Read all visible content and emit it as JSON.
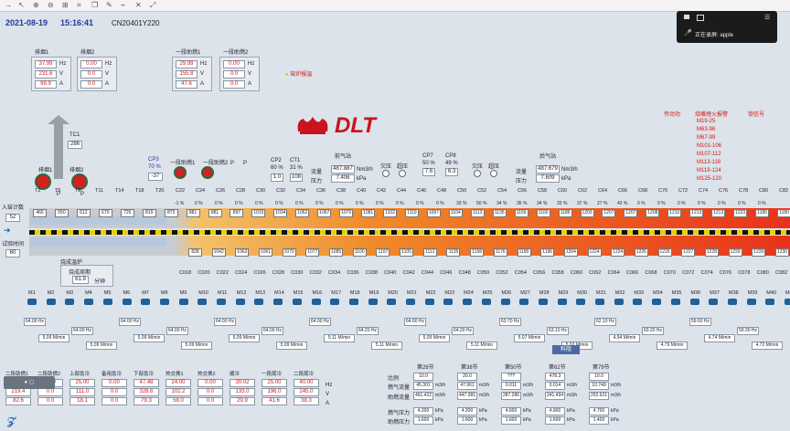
{
  "toolbar": {
    "icons": [
      "back-arrow",
      "cursor",
      "zoom-in",
      "zoom-out",
      "zoom-fit",
      "crop",
      "copy",
      "pen",
      "paperclip",
      "close-x",
      "expand"
    ]
  },
  "header": {
    "date": "2021-08-19",
    "time": "15:16:41",
    "code": "CN20401Y220"
  },
  "overlay": {
    "label": "正在录屏: apple"
  },
  "fans": [
    {
      "title": "排烟1",
      "hz": "37.99",
      "v": "231.6",
      "a": "99.9"
    },
    {
      "title": "排烟2",
      "hz": "0.00",
      "v": "0.0",
      "a": "0.0"
    },
    {
      "title": "一段助燃1",
      "hz": "29.99",
      "v": "155.8",
      "a": "47.6"
    },
    {
      "title": "一段助燃2",
      "hz": "0.00",
      "v": "0.0",
      "a": "0.0"
    }
  ],
  "units": {
    "hz": "Hz",
    "v": "V",
    "a": "A"
  },
  "kiln_alarm": "窑炉报温",
  "logo": "DLT",
  "tc1": {
    "label": "TC1",
    "value": "286"
  },
  "exhaust_labels": {
    "f1": "排烟1",
    "f2": "排烟2",
    "p": "P"
  },
  "burner_labels": {
    "b1": "一段助燃1",
    "b2": "一段助燃2",
    "p": "P"
  },
  "cp3": {
    "label": "CP3",
    "pct": "70 %",
    "val": "-37"
  },
  "cp2": {
    "label": "CP2",
    "pct": "60 %",
    "val": "1.0"
  },
  "ct1": {
    "label": "CT1",
    "pct": "31 %",
    "val": "108"
  },
  "front_gas": {
    "title": "前气站",
    "flow_label": "流量",
    "flow": "487.887",
    "flow_unit": "Nm3/h",
    "press_label": "压力",
    "press": "7.406",
    "press_unit": "kPa"
  },
  "rear_gas": {
    "title": "后气站",
    "flow_label": "流量",
    "flow": "487.679",
    "flow_unit": "Nm3/h",
    "press_label": "压力",
    "press": "7.609",
    "press_unit": "kPa"
  },
  "cp7": {
    "label": "CP7",
    "pct": "50 %",
    "val": "7.6"
  },
  "cp8": {
    "label": "CP8",
    "pct": "49 %",
    "val": "6.3"
  },
  "pressure_marks": {
    "under": "欠压",
    "over": "超压"
  },
  "right_red": {
    "title1": "传动功",
    "title2": "烧嘴熄火报警",
    "title3": "锁信号",
    "items": [
      "M19-25",
      "M63-96",
      "M67-99",
      "M101-106",
      "M107-112",
      "M113-118",
      "M119-124",
      "M125-120"
    ]
  },
  "entry": {
    "count_label": "入窑计数",
    "count": "52",
    "time_label": "试验时间",
    "time": "60"
  },
  "zone_top": [
    "T2",
    "T5",
    "T8",
    "T11",
    "T14",
    "T18",
    "T20",
    "C22",
    "C24",
    "C26",
    "C28",
    "C30",
    "C32",
    "C34",
    "C36",
    "C38",
    "C40",
    "C42",
    "C44",
    "C46",
    "C48",
    "C50",
    "C52",
    "C54",
    "C56",
    "C58",
    "C60",
    "C62",
    "C64",
    "C66",
    "C68",
    "C70",
    "C72",
    "C74",
    "C76",
    "C78",
    "C80",
    "C82"
  ],
  "top_temps": [
    "466",
    "550",
    "612",
    "670",
    "726",
    "819",
    "873",
    "881",
    "881",
    "897",
    "1015",
    "1034",
    "1062",
    "1067",
    "1070",
    "1081",
    "1102",
    "1119",
    "1097",
    "1104",
    "1113",
    "1135",
    "1156",
    "1160",
    "1186",
    "1203",
    "1207",
    "1207",
    "1208",
    "1210",
    "1213",
    "1213",
    "1223",
    "1180",
    "1180"
  ],
  "top_pct": [
    "-1 %",
    "0 %",
    "0 %",
    "0 %",
    "0 %",
    "0 %",
    "0 %",
    "0 %",
    "0 %",
    "0 %",
    "0 %",
    "0 %",
    "0 %",
    "0 %",
    "33 %",
    "50 %",
    "34 %",
    "36 %",
    "34 %",
    "33 %",
    "37 %",
    "27 %",
    "42 %",
    "0 %",
    "0 %",
    "0 %",
    "0 %",
    "0 %",
    "0 %",
    "0 %"
  ],
  "bottom_temps": [
    "828",
    "1042",
    "1062",
    "1061",
    "1070",
    "1077",
    "1085",
    "1100",
    "1107",
    "1105",
    "1112",
    "1135",
    "1158",
    "1176",
    "1180",
    "1196",
    "1204",
    "1224",
    "1224",
    "1226",
    "1226",
    "1227",
    "1228",
    "1229",
    "1230",
    "1230"
  ],
  "zone_bottom": [
    "C018",
    "C020",
    "C022",
    "C024",
    "C026",
    "C028",
    "C030",
    "C032",
    "C034",
    "C036",
    "C038",
    "C040",
    "C042",
    "C044",
    "C046",
    "C048",
    "C050",
    "C052",
    "C054",
    "C056",
    "C058",
    "C060",
    "C062",
    "C064",
    "C066",
    "C068",
    "C070",
    "C072",
    "C074",
    "C076",
    "C078",
    "C080",
    "C082"
  ],
  "firing": {
    "title": "烧成温炉",
    "cycle_label": "烧成周期",
    "cycle": "61.9",
    "cycle_unit": "分钟"
  },
  "motors": [
    "M1",
    "M2",
    "M3",
    "M4",
    "M5",
    "M6",
    "M7",
    "M8",
    "M9",
    "M10",
    "M11",
    "M12",
    "M13",
    "M14",
    "M15",
    "M16",
    "M17",
    "M18",
    "M19",
    "M20",
    "M21",
    "M22",
    "M23",
    "M24",
    "M25",
    "M26",
    "M27",
    "M28",
    "M29",
    "M30",
    "M31",
    "M32",
    "M33",
    "M34",
    "M35",
    "M36",
    "M37",
    "M38",
    "M39",
    "M40",
    "M41"
  ],
  "drives": [
    {
      "hz": "64.00 Hz",
      "speed": "5.09 M/min"
    },
    {
      "hz": "64.00 Hz",
      "speed": "5.09 M/min"
    },
    {
      "hz": "64.00 Hz",
      "speed": "5.09 M/min"
    },
    {
      "hz": "64.00 Hz",
      "speed": "5.09 M/min"
    },
    {
      "hz": "64.00 Hz",
      "speed": "5.09 M/min"
    },
    {
      "hz": "64.00 Hz",
      "speed": "5.09 M/min"
    },
    {
      "hz": "64.00 Hz",
      "speed": "5.11 M/min"
    },
    {
      "hz": "64.20 Hz",
      "speed": "5.11 M/min"
    },
    {
      "hz": "64.00 Hz",
      "speed": "5.09 M/min"
    },
    {
      "hz": "64.20 Hz",
      "speed": "5.11 M/min"
    },
    {
      "hz": "63.70 Hz",
      "speed": "5.07 M/min"
    },
    {
      "hz": "63.10 Hz",
      "speed": "5.02 M/min"
    },
    {
      "hz": "62.10 Hz",
      "speed": "4.94 M/min"
    },
    {
      "hz": "60.20 Hz",
      "speed": "4.79 M/min"
    },
    {
      "hz": "59.60 Hz",
      "speed": "4.74 M/min"
    },
    {
      "hz": "59.30 Hz",
      "speed": "4.72 M/min"
    }
  ],
  "bottom_fans": [
    {
      "title": "二段助燃1",
      "vals": [
        "30.00",
        "219.4",
        "82.6"
      ]
    },
    {
      "title": "二段助燃2",
      "vals": [
        "0.00",
        "0.0",
        "0.0"
      ]
    },
    {
      "title": "上部急冷",
      "vals": [
        "25.00",
        "111.0",
        "18.1"
      ]
    },
    {
      "title": "备用急冷",
      "vals": [
        "0.00",
        "0.0",
        "0.0"
      ]
    },
    {
      "title": "下部急冷",
      "vals": [
        "47.48",
        "328.6",
        "79.3"
      ]
    },
    {
      "title": "热交换1",
      "vals": [
        "24.00",
        "102.2",
        "58.0"
      ]
    },
    {
      "title": "热交换2",
      "vals": [
        "0.00",
        "0.0",
        "0.0"
      ]
    },
    {
      "title": "缓冷",
      "vals": [
        "30.02",
        "133.0",
        "29.9"
      ]
    },
    {
      "title": "一段尾冷",
      "vals": [
        "25.00",
        "196.0",
        "41.6"
      ]
    },
    {
      "title": "二段尾冷",
      "vals": [
        "40.00",
        "245.0",
        "38.3"
      ]
    }
  ],
  "bottom_units": [
    "Hz",
    "V",
    "A"
  ],
  "sections": {
    "row_labels": [
      "比例",
      "燃气流量",
      "助燃流量",
      "燃气压力",
      "助燃压力"
    ],
    "cols": [
      {
        "title": "第26节",
        "vals": [
          "10.0",
          "45.301",
          "461.422",
          "4.200",
          "1.600"
        ],
        "units": [
          "",
          "m3/h",
          "m3/h",
          "kPa",
          "kPa"
        ]
      },
      {
        "title": "第38节",
        "vals": [
          "20.0",
          "47.961",
          "447.381",
          "4.200",
          "1.600"
        ],
        "units": [
          "",
          "m3/h",
          "m3/h",
          "kPa",
          "kPa"
        ]
      },
      {
        "title": "第50节",
        "vals": [
          "???",
          "0.011",
          "287.286",
          "4.600",
          "1.600"
        ],
        "units": [
          "",
          "m3/h",
          "m3/h",
          "kPa",
          "kPa"
        ]
      },
      {
        "title": "第62节",
        "vals": [
          "478.3",
          "0.014",
          "241.494",
          "4.900",
          "1.600"
        ],
        "units": [
          "",
          "m3/h",
          "m3/h",
          "kPa",
          "kPa"
        ]
      },
      {
        "title": "第79节",
        "vals": [
          "10.0",
          "10.749",
          "202.621",
          "4.700",
          "1.400"
        ],
        "units": [
          "",
          "m3/h",
          "m3/h",
          "kPa",
          "kPa"
        ]
      }
    ]
  },
  "btn_more": "料阻",
  "colors": {
    "accent": "#1e3a9a",
    "hot": "#e83a1a",
    "warm": "#f5a623",
    "logo_red": "#c8141e"
  }
}
